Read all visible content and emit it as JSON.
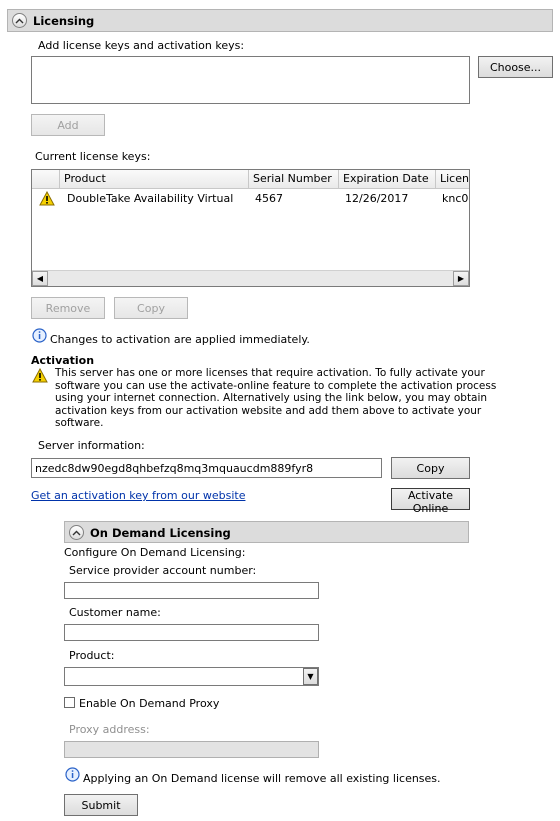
{
  "licensing": {
    "header": "Licensing",
    "add_keys_label": "Add license keys and activation keys:",
    "keys_input_value": "",
    "choose_button": "Choose...",
    "add_button": "Add",
    "current_keys_label": "Current license keys:",
    "columns": [
      "Product",
      "Serial Number",
      "Expiration Date",
      "Licen"
    ],
    "rows": [
      {
        "status_icon": "warning-icon",
        "product": "DoubleTake Availability Virtual",
        "serial": "4567",
        "expiration": "12/26/2017",
        "license": "knc0-"
      }
    ],
    "remove_button": "Remove",
    "copy_button": "Copy",
    "info_text": "Changes to activation are applied immediately."
  },
  "activation": {
    "heading": "Activation",
    "warning_lines": [
      "This server has one or more licenses that require activation. To fully activate your",
      "software you can use the activate-online feature to complete the activation process",
      "using your internet connection. Alternatively using the link below, you may obtain",
      "activation keys from our activation website and add them above to activate your",
      "software."
    ],
    "server_info_label": "Server information:",
    "server_info_value": "nzedc8dw90egd8qhbefzq8mq3mquaucdm889fyr8",
    "copy_button": "Copy",
    "link_text": "Get an activation key from our website",
    "activate_button": "Activate Online"
  },
  "on_demand": {
    "header": "On Demand Licensing",
    "configure_label": "Configure On Demand Licensing:",
    "account_label": "Service provider account number:",
    "account_value": "",
    "customer_label": "Customer name:",
    "customer_value": "",
    "product_label": "Product:",
    "product_value": "",
    "proxy_checkbox_label": "Enable On Demand Proxy",
    "proxy_checked": false,
    "proxy_address_label": "Proxy address:",
    "proxy_address_value": "",
    "info_text": "Applying an On Demand license will remove all existing licenses.",
    "submit_button": "Submit"
  },
  "colors": {
    "header_bg": "#dcdcdc",
    "link": "#0033aa",
    "warning": "#f5d000"
  }
}
